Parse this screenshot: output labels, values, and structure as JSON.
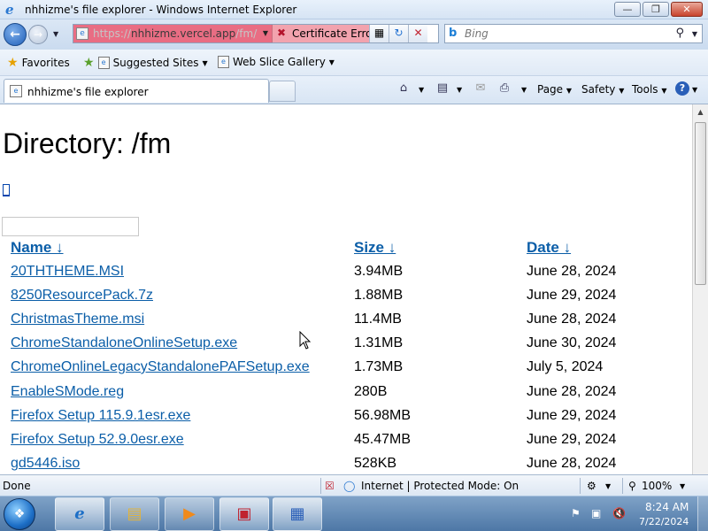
{
  "window": {
    "title": "nhhizme's file explorer - Windows Internet Explorer"
  },
  "address": {
    "url_prefix": "https://",
    "url_host": "nhhizme.vercel.app",
    "url_path": "/fm/",
    "cert_error_label": "Certificate Error"
  },
  "search": {
    "placeholder": "Bing"
  },
  "favorites": {
    "favorites_label": "Favorites",
    "suggested_label": "Suggested Sites",
    "webslice_label": "Web Slice Gallery"
  },
  "tab": {
    "label": "nhhizme's file explorer"
  },
  "commands": {
    "page_label": "Page",
    "safety_label": "Safety",
    "tools_label": "Tools"
  },
  "page": {
    "heading": "Directory: /fm",
    "columns": {
      "name": "Name  ↓ ",
      "size": "Size  ↓ ",
      "date": "Date  ↓ "
    },
    "files": [
      {
        "name": "20THTHEME.MSI",
        "size": "3.94MB",
        "date": "June 28, 2024"
      },
      {
        "name": "8250ResourcePack.7z",
        "size": "1.88MB",
        "date": "June 29, 2024"
      },
      {
        "name": "ChristmasTheme.msi",
        "size": "11.4MB",
        "date": "June 28, 2024"
      },
      {
        "name": "ChromeStandaloneOnlineSetup.exe",
        "size": "1.31MB",
        "date": "June 30, 2024"
      },
      {
        "name": "ChromeOnlineLegacyStandalonePAFSetup.exe",
        "size": "1.73MB",
        "date": "July 5, 2024"
      },
      {
        "name": "EnableSMode.reg",
        "size": "280B",
        "date": "June 28, 2024"
      },
      {
        "name": "Firefox Setup 115.9.1esr.exe",
        "size": "56.98MB",
        "date": "June 29, 2024"
      },
      {
        "name": "Firefox Setup 52.9.0esr.exe",
        "size": "45.47MB",
        "date": "June 29, 2024"
      },
      {
        "name": "gd5446.iso",
        "size": "528KB",
        "date": "June 28, 2024"
      }
    ]
  },
  "status": {
    "left": "Done",
    "zone": "Internet | Protected Mode: On",
    "zoom": "100%"
  },
  "taskbar": {
    "time": "8:24 AM",
    "date": "7/22/2024"
  }
}
